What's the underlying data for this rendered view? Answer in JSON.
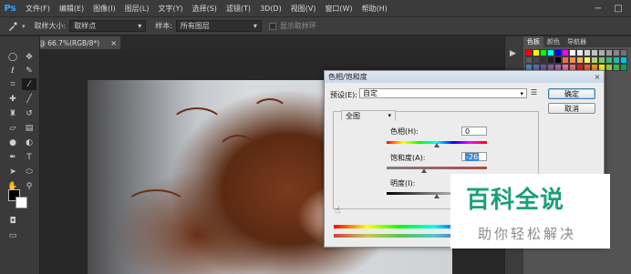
{
  "app": {
    "logo": "Ps"
  },
  "menu": [
    "文件(F)",
    "编辑(E)",
    "图像(I)",
    "图层(L)",
    "文字(Y)",
    "选择(S)",
    "滤镜(T)",
    "3D(D)",
    "视图(V)",
    "窗口(W)",
    "帮助(H)"
  ],
  "window_controls": {
    "minimize": "−",
    "restore": "□"
  },
  "options": {
    "sample_size_label": "取样大小:",
    "sample_size_value": "取样点",
    "sample_label": "样本:",
    "sample_value": "所有图层",
    "show_ring_label": "显示取样环"
  },
  "document_tab": ".jpg @ 66.7%(RGB/8*)",
  "panels": {
    "tabs": [
      "色板",
      "颜色",
      "导航器"
    ]
  },
  "swatch_colors": [
    "#ff0000",
    "#ffff00",
    "#00ff00",
    "#00ffff",
    "#0000ff",
    "#ff00ff",
    "#ffffff",
    "#ebebeb",
    "#d6d6d6",
    "#c2c2c2",
    "#adadad",
    "#999999",
    "#858585",
    "#707070",
    "#5c5c5c",
    "#474747",
    "#333333",
    "#1f1f1f",
    "#000000",
    "#f26c4f",
    "#f68e55",
    "#fbaf5c",
    "#fff467",
    "#acd372",
    "#7dc473",
    "#3cb878",
    "#1cbbb4",
    "#00bff3",
    "#438ccb",
    "#5574b9",
    "#605ca8",
    "#855fa8",
    "#a763a8",
    "#f06ea9",
    "#f26d7d",
    "#ed1c24",
    "#f26522",
    "#f7941d",
    "#fff200",
    "#8dc63f",
    "#39b54a",
    "#00a651"
  ],
  "dialog": {
    "title": "色相/饱和度",
    "close": "×",
    "preset_label": "预设(E):",
    "preset_value": "自定",
    "ok": "确定",
    "cancel": "取消",
    "channel": "全图",
    "hue_label": "色相(H):",
    "hue_value": "0",
    "saturation_label": "饱和度(A):",
    "saturation_value": "-26",
    "lightness_label": "明度(I):"
  },
  "adjustments": {
    "hue": 0,
    "saturation": -26,
    "lightness": 0
  },
  "watermark": {
    "title": "百科全说",
    "subtitle": "助你轻松解决"
  }
}
